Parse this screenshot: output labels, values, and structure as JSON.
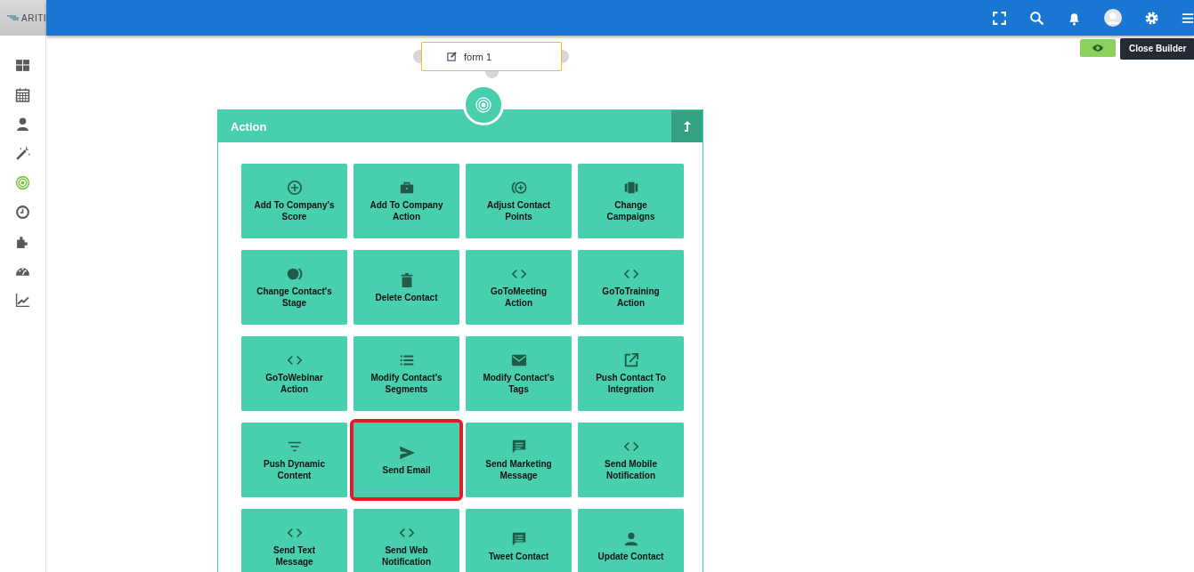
{
  "logo": {
    "text": "ARITI"
  },
  "topbar": {
    "icons": [
      {
        "kind": "fullscreen"
      },
      {
        "kind": "search"
      },
      {
        "kind": "bell"
      },
      {
        "kind": "avatar"
      },
      {
        "kind": "settings"
      },
      {
        "kind": "menu"
      }
    ]
  },
  "sidebar": {
    "items": [
      {
        "kind": "dashboard",
        "selected": false
      },
      {
        "kind": "calendar",
        "selected": false
      },
      {
        "kind": "person",
        "selected": false
      },
      {
        "kind": "wand",
        "selected": false
      },
      {
        "kind": "target",
        "selected": true
      },
      {
        "kind": "clock",
        "selected": false
      },
      {
        "kind": "puzzle",
        "selected": false
      },
      {
        "kind": "gauge",
        "selected": false
      },
      {
        "kind": "chart",
        "selected": false
      }
    ]
  },
  "builder": {
    "tooltip": "Close Builder"
  },
  "form_node": {
    "label": "form 1"
  },
  "action_panel": {
    "title": "Action",
    "tiles": [
      {
        "label": "Add To Company's Score",
        "kind": "plus-circle",
        "highlighted": false
      },
      {
        "label": "Add To Company Action",
        "kind": "briefcase",
        "highlighted": false
      },
      {
        "label": "Adjust Contact Points",
        "kind": "plus-circle-arc",
        "highlighted": false
      },
      {
        "label": "Change Campaigns",
        "kind": "columns",
        "highlighted": false
      },
      {
        "label": "Change Contact's Stage",
        "kind": "stage",
        "highlighted": false
      },
      {
        "label": "Delete Contact",
        "kind": "trash",
        "highlighted": false
      },
      {
        "label": "GoToMeeting Action",
        "kind": "code",
        "highlighted": false
      },
      {
        "label": "GoToTraining Action",
        "kind": "code",
        "highlighted": false
      },
      {
        "label": "GoToWebinar Action",
        "kind": "code",
        "highlighted": false
      },
      {
        "label": "Modify Contact's Segments",
        "kind": "list",
        "highlighted": false
      },
      {
        "label": "Modify Contact's Tags",
        "kind": "envelope",
        "highlighted": false
      },
      {
        "label": "Push Contact To Integration",
        "kind": "external",
        "highlighted": false
      },
      {
        "label": "Push Dynamic Content",
        "kind": "filter",
        "highlighted": false
      },
      {
        "label": "Send Email",
        "kind": "send",
        "highlighted": true
      },
      {
        "label": "Send Marketing Message",
        "kind": "message",
        "highlighted": false
      },
      {
        "label": "Send Mobile Notification",
        "kind": "code",
        "highlighted": false
      },
      {
        "label": "Send Text Message",
        "kind": "code",
        "highlighted": false
      },
      {
        "label": "Send Web Notification",
        "kind": "code",
        "highlighted": false
      },
      {
        "label": "Tweet Contact",
        "kind": "comment-list",
        "highlighted": false
      },
      {
        "label": "Update Contact",
        "kind": "person",
        "highlighted": false
      }
    ]
  }
}
